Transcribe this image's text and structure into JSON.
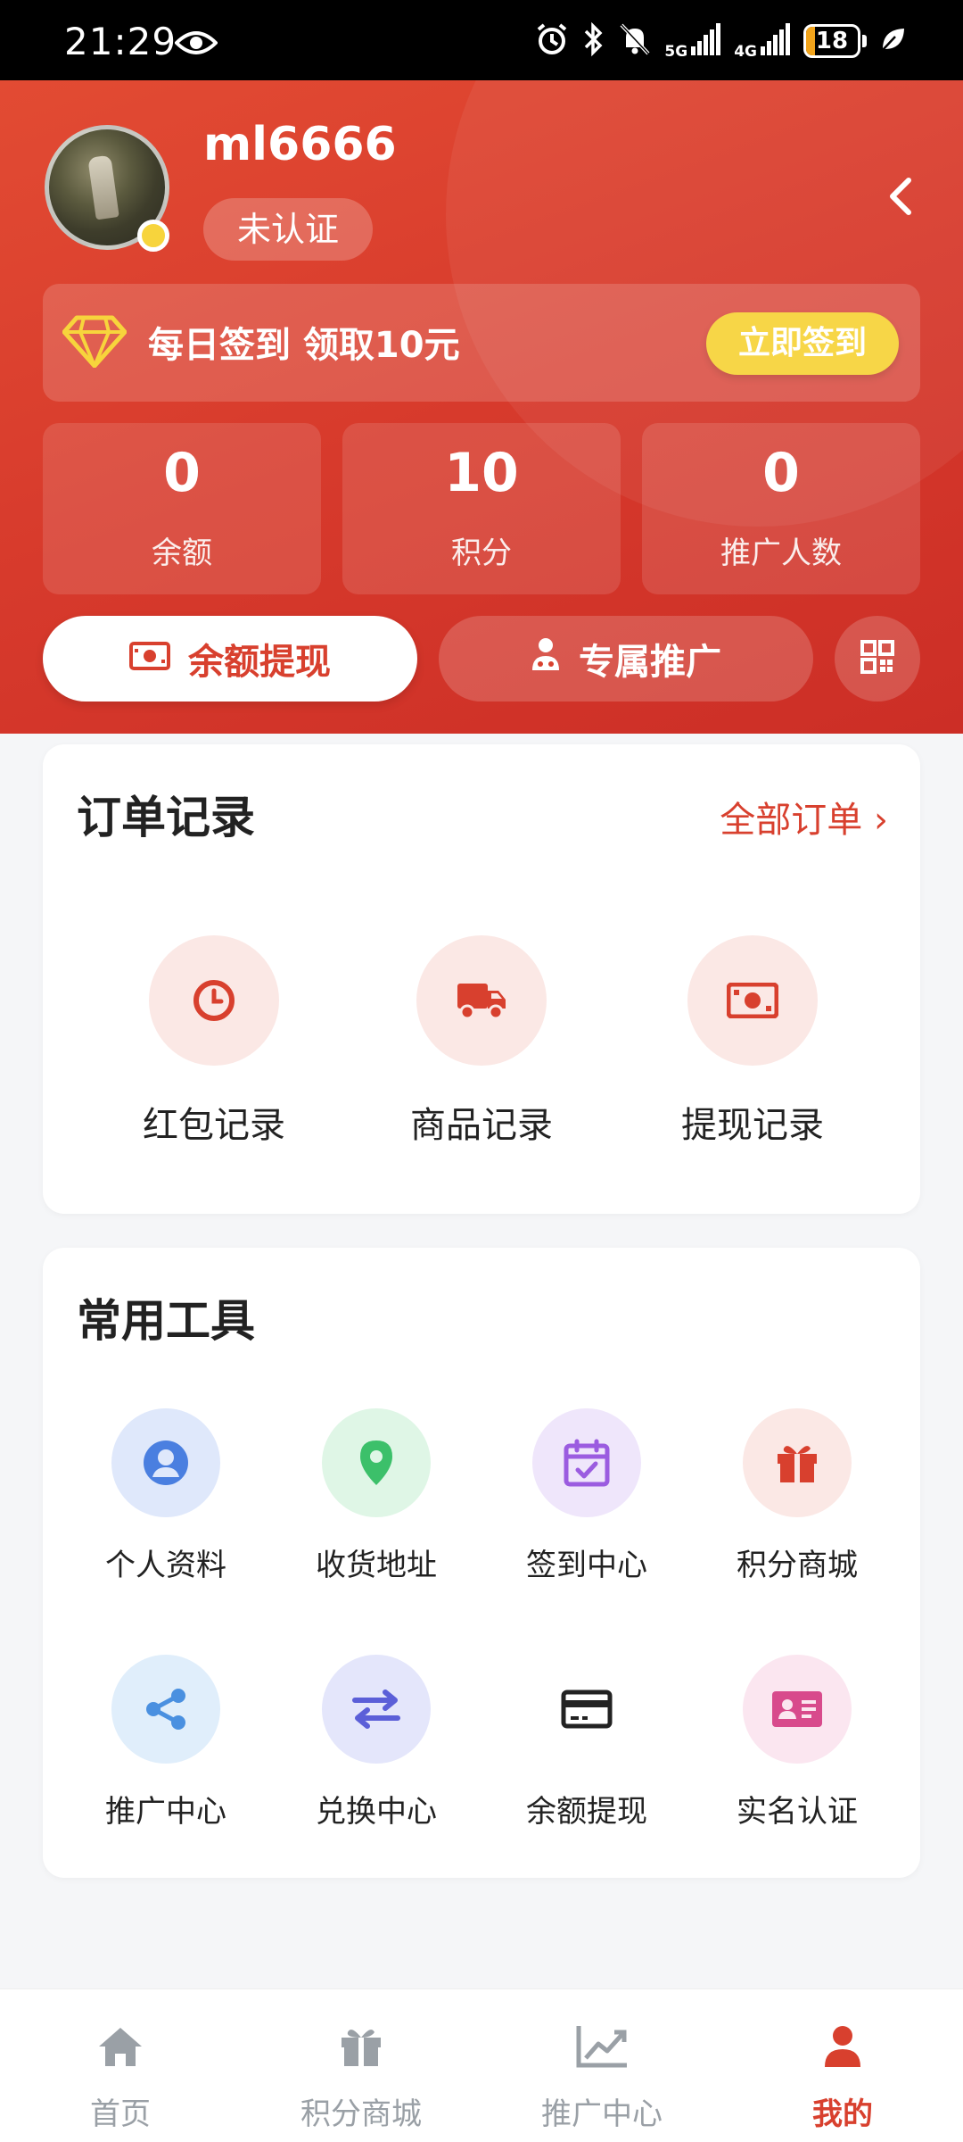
{
  "status_bar": {
    "time": "21:29",
    "network_5g": "5G",
    "network_4g": "4G",
    "battery": "18",
    "battery_level": 0.18
  },
  "header": {
    "username": "ml6666",
    "verify_status": "未认证",
    "signin": {
      "text": "每日签到 领取10元",
      "button": "立即签到"
    },
    "stats": [
      {
        "value": "0",
        "label": "余额"
      },
      {
        "value": "10",
        "label": "积分"
      },
      {
        "value": "0",
        "label": "推广人数"
      }
    ],
    "actions": {
      "withdraw": "余额提现",
      "promo": "专属推广"
    }
  },
  "orders": {
    "title": "订单记录",
    "all_link": "全部订单 ›",
    "items": [
      {
        "label": "红包记录",
        "icon": "clock-icon"
      },
      {
        "label": "商品记录",
        "icon": "truck-icon"
      },
      {
        "label": "提现记录",
        "icon": "money-icon"
      }
    ]
  },
  "tools": {
    "title": "常用工具",
    "items": [
      {
        "label": "个人资料",
        "icon": "user-circle-icon",
        "bg": "#dfe8fb",
        "color": "#4a7fe0"
      },
      {
        "label": "收货地址",
        "icon": "location-pin-icon",
        "bg": "#dff6e6",
        "color": "#3cc06a"
      },
      {
        "label": "签到中心",
        "icon": "calendar-check-icon",
        "bg": "#efe6fb",
        "color": "#9b5ce0"
      },
      {
        "label": "积分商城",
        "icon": "gift-icon",
        "bg": "#fbe8e5",
        "color": "#d8402e"
      },
      {
        "label": "推广中心",
        "icon": "share-icon",
        "bg": "#e0eefb",
        "color": "#4a90e0"
      },
      {
        "label": "兑换中心",
        "icon": "exchange-icon",
        "bg": "#e4e6fb",
        "color": "#5b5fd8"
      },
      {
        "label": "余额提现",
        "icon": "credit-card-icon",
        "bg": "#ffffff",
        "color": "#222222"
      },
      {
        "label": "实名认证",
        "icon": "id-card-icon",
        "bg": "#fbe6f0",
        "color": "#d84a8c"
      }
    ]
  },
  "bottom_nav": {
    "items": [
      {
        "label": "首页",
        "icon": "home-icon"
      },
      {
        "label": "积分商城",
        "icon": "gift-icon"
      },
      {
        "label": "推广中心",
        "icon": "chart-line-icon"
      },
      {
        "label": "我的",
        "icon": "user-icon",
        "active": true
      }
    ]
  },
  "colors": {
    "primary": "#d8402e",
    "accent_yellow": "#f7d43c",
    "inactive": "#9aa0a6"
  }
}
